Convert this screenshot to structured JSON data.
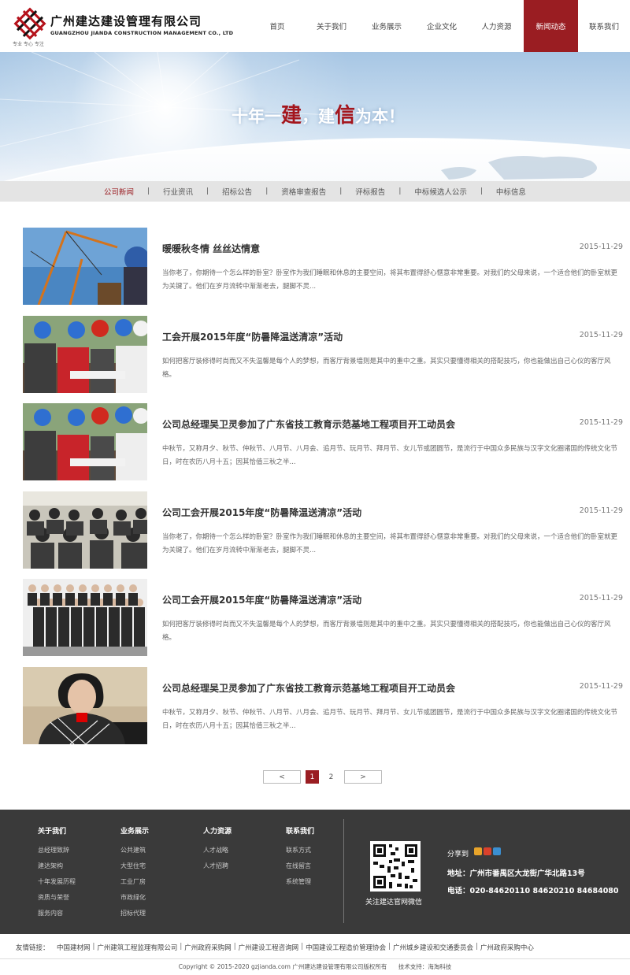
{
  "header": {
    "company_name_cn": "广州建达建设管理有限公司",
    "company_name_en": "GUANGZHOU JIANDA CONSTRUCTION MANAGEMENT CO., LTD",
    "slogan": "专业  专心  专注"
  },
  "nav": {
    "items": [
      {
        "label": "首页",
        "active": false
      },
      {
        "label": "关于我们",
        "active": false
      },
      {
        "label": "业务展示",
        "active": false
      },
      {
        "label": "企业文化",
        "active": false
      },
      {
        "label": "人力资源",
        "active": false
      },
      {
        "label": "新闻动态",
        "active": true
      },
      {
        "label": "联系我们",
        "active": false
      }
    ]
  },
  "banner": {
    "slogan_part1": "十年一",
    "slogan_hl1": "建",
    "slogan_part2": "，建",
    "slogan_hl2": "信",
    "slogan_part3": "为本！"
  },
  "subnav": {
    "items": [
      {
        "label": "公司新闻",
        "active": true
      },
      {
        "label": "行业资讯",
        "active": false
      },
      {
        "label": "招标公告",
        "active": false
      },
      {
        "label": "资格审查报告",
        "active": false
      },
      {
        "label": "评标报告",
        "active": false
      },
      {
        "label": "中标候选人公示",
        "active": false
      },
      {
        "label": "中标信息",
        "active": false
      }
    ],
    "separator": "|"
  },
  "news": [
    {
      "title": "暖暖秋冬情 丝丝达情意",
      "date": "2015-11-29",
      "summary": "当你老了，你期待一个怎么样的卧室？卧室作为我们睡眠和休息的主要空间，将其布置得舒心惬意非常重要。对我们的父母来说，一个适合他们的卧室就更为关键了。他们在岁月流转中渐渐老去，腿脚不灵...",
      "thumb": "cranes"
    },
    {
      "title": "工会开展2015年度“防暑降温送清凉”活动",
      "date": "2015-11-29",
      "summary": "如何把客厅装修得时尚而又不失温馨是每个人的梦想，而客厅背景墙则是其中的重中之重。其实只要懂得相关的搭配技巧，你也能做出自己心仪的客厅风格。",
      "thumb": "hardhats"
    },
    {
      "title": "公司总经理吴卫灵参加了广东省技工教育示范基地工程项目开工动员会",
      "date": "2015-11-29",
      "summary": "中秋节，又称月夕、秋节、仲秋节、八月节、八月会、追月节、玩月节、拜月节、女儿节或团圆节，是流行于中国众多民族与汉字文化圈诸国的传统文化节日，时在农历八月十五；因其恰值三秋之半...",
      "thumb": "hardhats"
    },
    {
      "title": "公司工会开展2015年度“防暑降温送清凉”活动",
      "date": "2015-11-29",
      "summary": "当你老了，你期待一个怎么样的卧室？卧室作为我们睡眠和休息的主要空间，将其布置得舒心惬意非常重要。对我们的父母来说，一个适合他们的卧室就更为关键了。他们在岁月流转中渐渐老去，腿脚不灵...",
      "thumb": "meeting"
    },
    {
      "title": "公司工会开展2015年度“防暑降温送清凉”活动",
      "date": "2015-11-29",
      "summary": "如何把客厅装修得时尚而又不失温馨是每个人的梦想，而客厅背景墙则是其中的重中之重。其实只要懂得相关的搭配技巧，你也能做出自己心仪的客厅风格。",
      "thumb": "group"
    },
    {
      "title": "公司总经理吴卫灵参加了广东省技工教育示范基地工程项目开工动员会",
      "date": "2015-11-29",
      "summary": "中秋节，又称月夕、秋节、仲秋节、八月节、八月会、追月节、玩月节、拜月节、女儿节或团圆节，是流行于中国众多民族与汉字文化圈诸国的传统文化节日，时在农历八月十五；因其恰值三秋之半...",
      "thumb": "portrait"
    }
  ],
  "pagination": {
    "prev": "<",
    "next": ">",
    "current": "1",
    "other": "2"
  },
  "footer": {
    "columns": [
      {
        "title": "关于我们",
        "links": [
          "总经理致辞",
          "建达架构",
          "十年发展历程",
          "资质与荣誉",
          "服务内容"
        ]
      },
      {
        "title": "业务展示",
        "links": [
          "公共建筑",
          "大型住宅",
          "工业厂房",
          "市政绿化",
          "招标代理"
        ]
      },
      {
        "title": "人力资源",
        "links": [
          "人才战略",
          "人才招聘"
        ]
      },
      {
        "title": "联系我们",
        "links": [
          "联系方式",
          "在线留言",
          "系统管理"
        ]
      }
    ],
    "qr_caption": "关注建达官网微信",
    "share_label": "分享到",
    "address": "地址：广州市番禺区大龙街广华北路13号",
    "phone": "电话：020-84620110  84620210  84684080"
  },
  "friends": {
    "label": "友情链接：",
    "links": [
      "中国建材网",
      "广州建筑工程监理有限公司",
      "广州政府采购网",
      "广州建设工程咨询网",
      "中国建设工程造价管理协会",
      "广州城乡建设和交通委员会",
      "广州政府采购中心"
    ]
  },
  "copyright": {
    "text": "Copyright © 2015-2020 gzjianda.com 广州建达建设管理有限公司版权所有",
    "support": "技术支持：海淘科技"
  },
  "colors": {
    "brand_red": "#9a1d22",
    "footer_bg": "#3a3a3a"
  }
}
